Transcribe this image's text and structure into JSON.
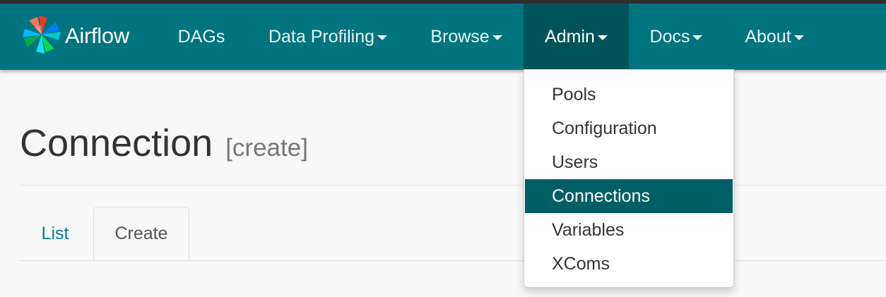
{
  "navbar": {
    "brand": "Airflow",
    "items": [
      {
        "label": "DAGs",
        "caret": false
      },
      {
        "label": "Data Profiling",
        "caret": true
      },
      {
        "label": "Browse",
        "caret": true
      },
      {
        "label": "Admin",
        "caret": true,
        "active": true
      },
      {
        "label": "Docs",
        "caret": true
      },
      {
        "label": "About",
        "caret": true
      }
    ]
  },
  "admin_menu": {
    "items": [
      "Pools",
      "Configuration",
      "Users",
      "Connections",
      "Variables",
      "XComs"
    ],
    "selected": "Connections"
  },
  "page": {
    "title": "Connection",
    "subtitle": "[create]"
  },
  "tabs": {
    "list": "List",
    "create": "Create",
    "active": "Create"
  },
  "colors": {
    "navbar": "#00747f",
    "navbar_active": "#00535a",
    "menu_active": "#005f66",
    "link": "#00818f"
  }
}
